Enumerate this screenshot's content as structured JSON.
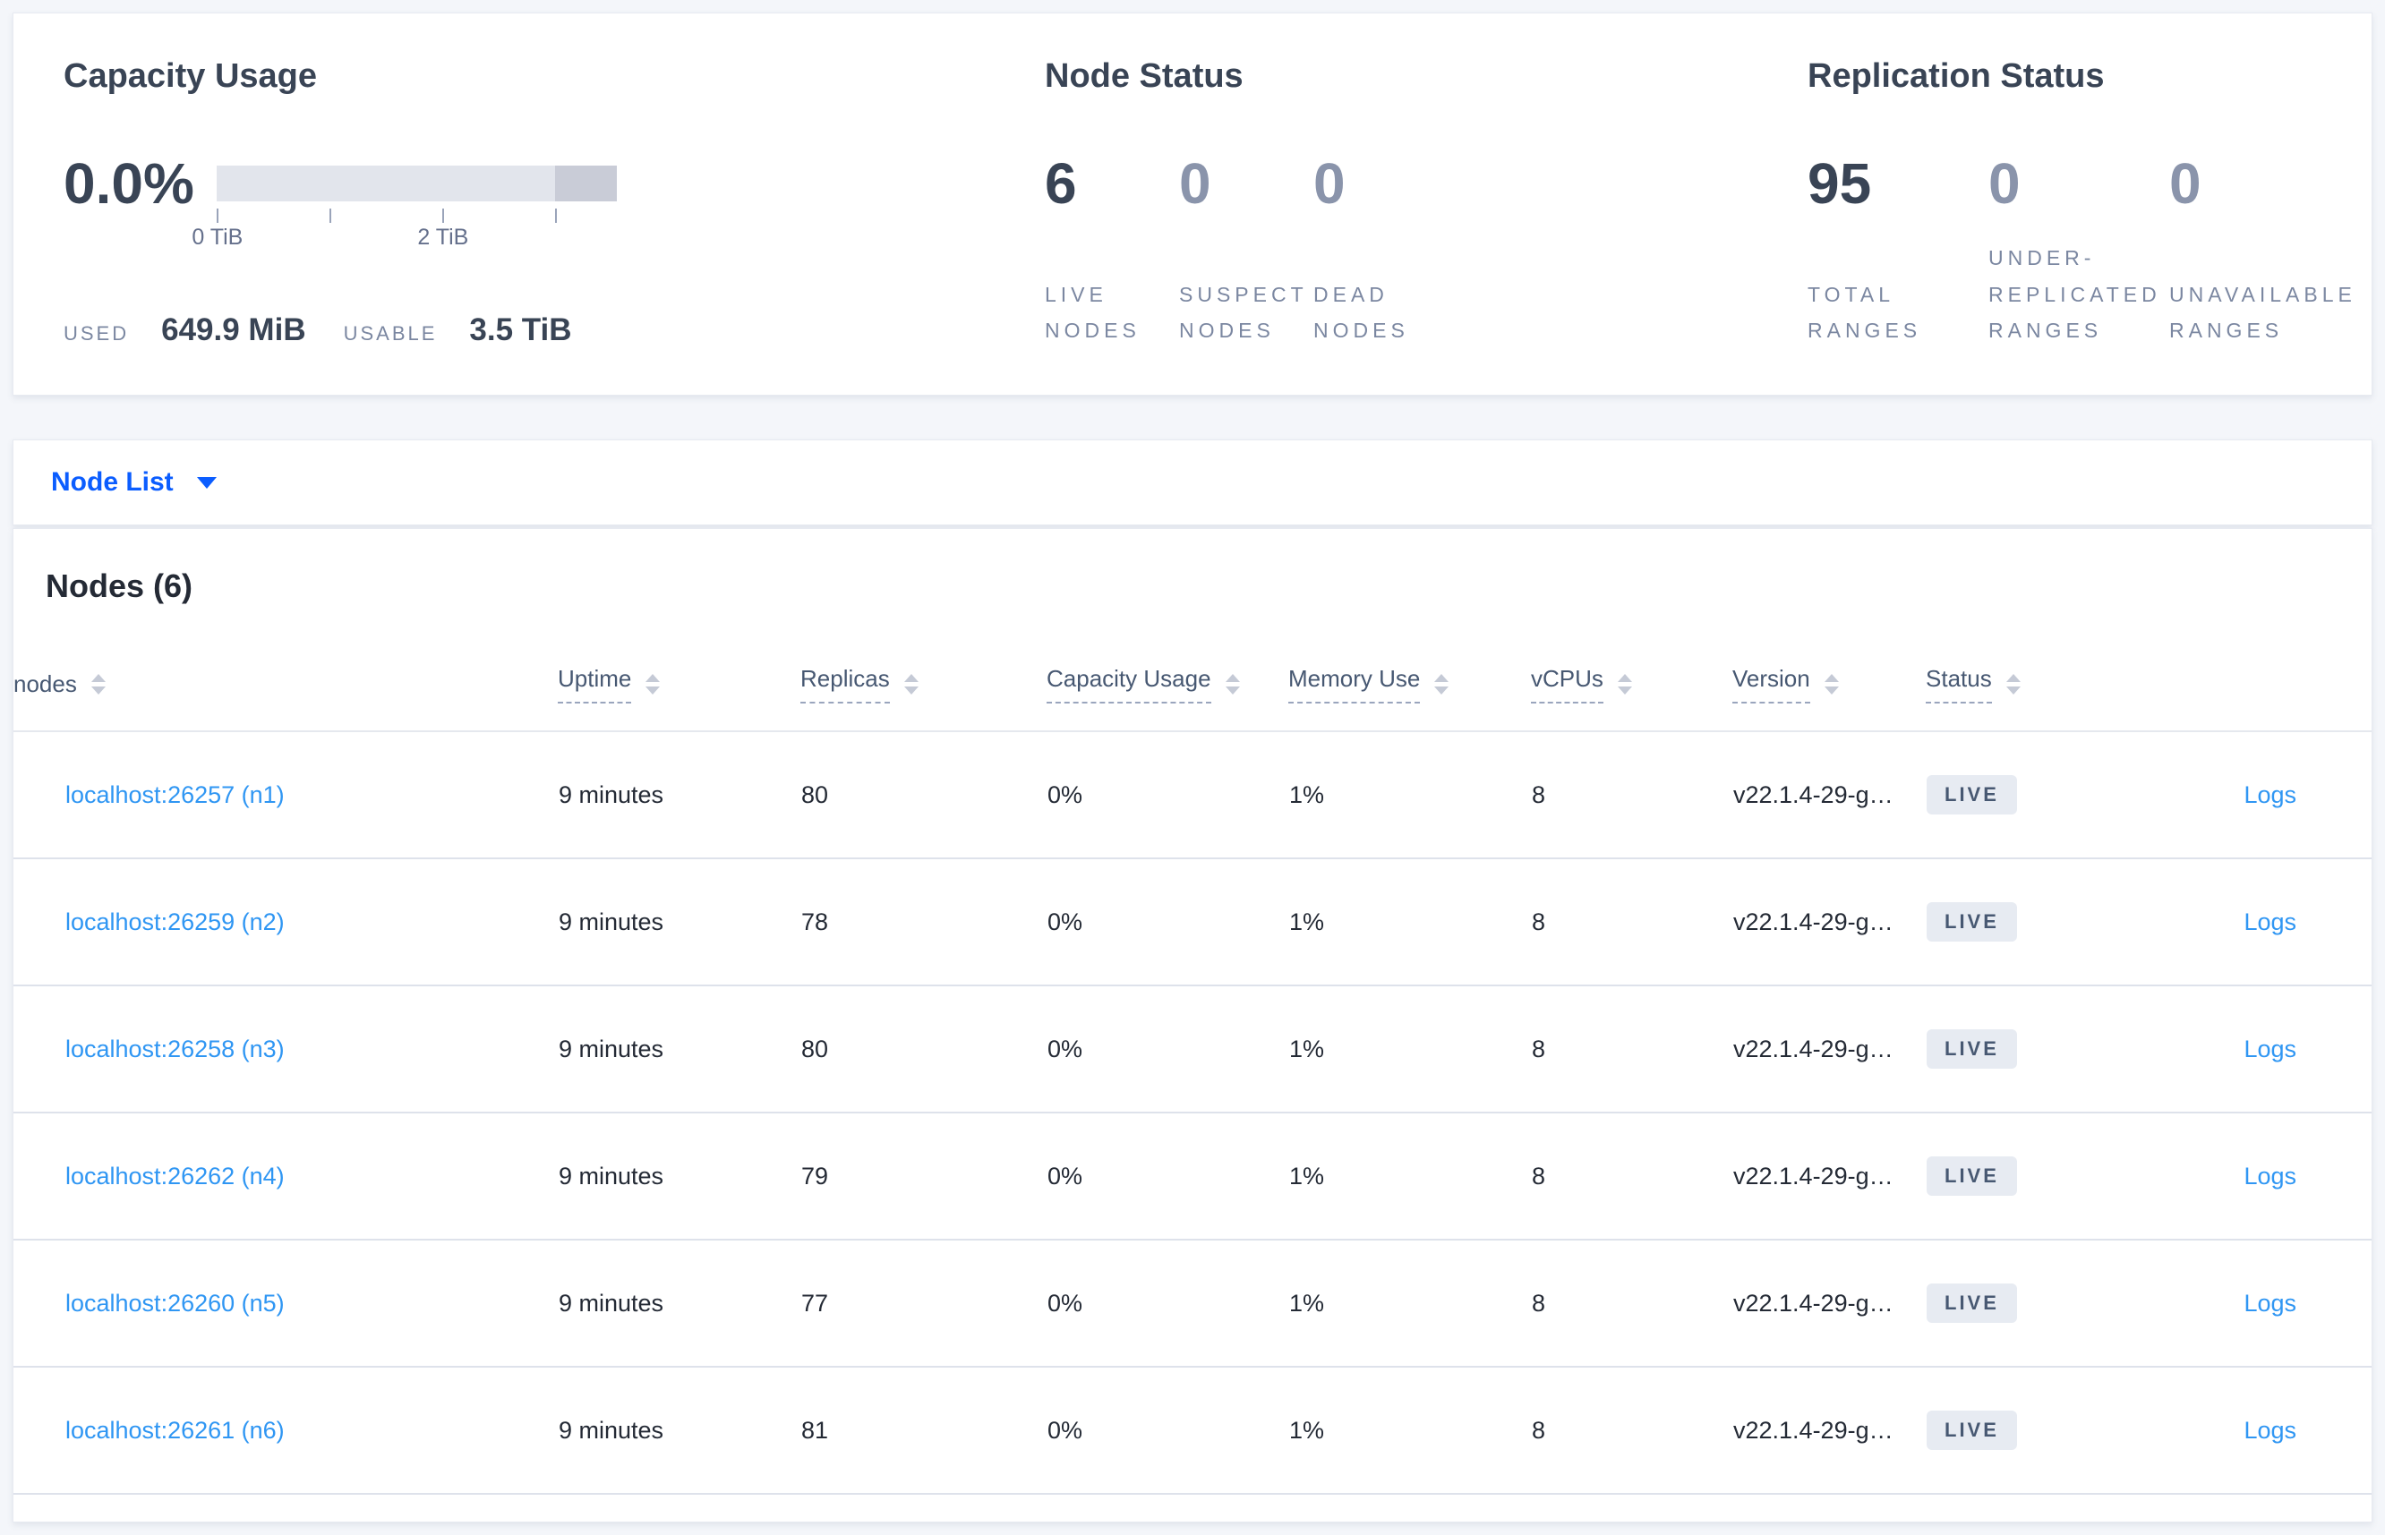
{
  "colors": {
    "accent-blue": "#0b5dff",
    "link-blue": "#2f96f3",
    "page-bg": "#f4f6fa",
    "text-slate": "#394455",
    "text-header": "#475872",
    "badge-bg": "#e7ebf2",
    "bar-base": "#e2e5ec",
    "bar-overflow": "#c9ccd7"
  },
  "capacity": {
    "title": "Capacity Usage",
    "percent": "0.0%",
    "used_label": "USED",
    "used_value": "649.9 MiB",
    "usable_label": "USABLE",
    "usable_value": "3.5 TiB",
    "bar": {
      "used_fraction": 0,
      "tick_labels": [
        "0 TiB",
        "",
        "2 TiB",
        ""
      ]
    }
  },
  "node_status": {
    "title": "Node Status",
    "stats": [
      {
        "value": "6",
        "label": "LIVE NODES",
        "muted": false
      },
      {
        "value": "0",
        "label": "SUSPECT NODES",
        "muted": true
      },
      {
        "value": "0",
        "label": "DEAD NODES",
        "muted": true
      }
    ]
  },
  "replication_status": {
    "title": "Replication Status",
    "stats": [
      {
        "value": "95",
        "label": "TOTAL RANGES",
        "muted": false
      },
      {
        "value": "0",
        "label": "UNDER-REPLICATED RANGES",
        "muted": true
      },
      {
        "value": "0",
        "label": "UNAVAILABLE RANGES",
        "muted": true
      }
    ]
  },
  "view_selector": {
    "label": "Node List"
  },
  "nodes_section": {
    "title": "Nodes (6)",
    "columns": [
      {
        "label": "nodes",
        "sortable": true,
        "tooltip": false
      },
      {
        "label": "Uptime",
        "sortable": true,
        "tooltip": true
      },
      {
        "label": "Replicas",
        "sortable": true,
        "tooltip": true
      },
      {
        "label": "Capacity Usage",
        "sortable": true,
        "tooltip": true
      },
      {
        "label": "Memory Use",
        "sortable": true,
        "tooltip": true
      },
      {
        "label": "vCPUs",
        "sortable": true,
        "tooltip": true
      },
      {
        "label": "Version",
        "sortable": true,
        "tooltip": true
      },
      {
        "label": "Status",
        "sortable": true,
        "tooltip": true
      },
      {
        "label": "",
        "sortable": false,
        "tooltip": false
      }
    ],
    "rows": [
      {
        "address": "localhost:26257 (n1)",
        "uptime": "9 minutes",
        "replicas": "80",
        "capacity_usage": "0%",
        "memory_use": "1%",
        "vcpus": "8",
        "version": "v22.1.4-29-g…",
        "status": "LIVE",
        "logs_label": "Logs"
      },
      {
        "address": "localhost:26259 (n2)",
        "uptime": "9 minutes",
        "replicas": "78",
        "capacity_usage": "0%",
        "memory_use": "1%",
        "vcpus": "8",
        "version": "v22.1.4-29-g…",
        "status": "LIVE",
        "logs_label": "Logs"
      },
      {
        "address": "localhost:26258 (n3)",
        "uptime": "9 minutes",
        "replicas": "80",
        "capacity_usage": "0%",
        "memory_use": "1%",
        "vcpus": "8",
        "version": "v22.1.4-29-g…",
        "status": "LIVE",
        "logs_label": "Logs"
      },
      {
        "address": "localhost:26262 (n4)",
        "uptime": "9 minutes",
        "replicas": "79",
        "capacity_usage": "0%",
        "memory_use": "1%",
        "vcpus": "8",
        "version": "v22.1.4-29-g…",
        "status": "LIVE",
        "logs_label": "Logs"
      },
      {
        "address": "localhost:26260 (n5)",
        "uptime": "9 minutes",
        "replicas": "77",
        "capacity_usage": "0%",
        "memory_use": "1%",
        "vcpus": "8",
        "version": "v22.1.4-29-g…",
        "status": "LIVE",
        "logs_label": "Logs"
      },
      {
        "address": "localhost:26261 (n6)",
        "uptime": "9 minutes",
        "replicas": "81",
        "capacity_usage": "0%",
        "memory_use": "1%",
        "vcpus": "8",
        "version": "v22.1.4-29-g…",
        "status": "LIVE",
        "logs_label": "Logs"
      }
    ]
  }
}
